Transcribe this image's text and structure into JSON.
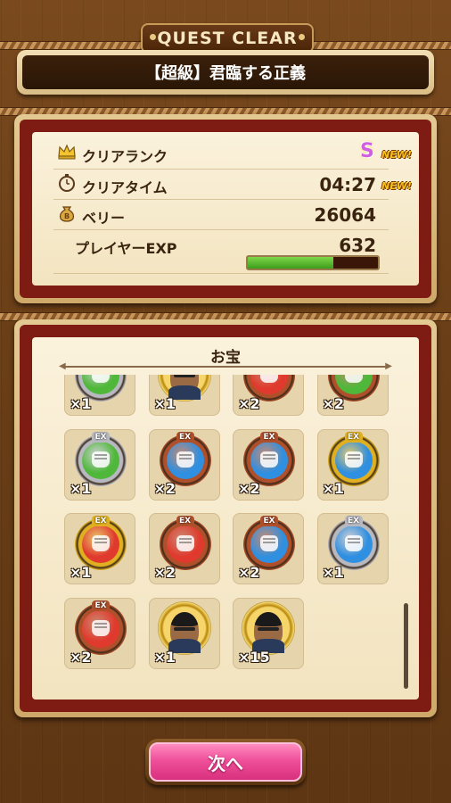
{
  "header": {
    "banner": "QUEST CLEAR",
    "quest_title": "【超級】君臨する正義"
  },
  "results": {
    "rank_label": "クリアランク",
    "rank_value": "S",
    "new_badge": "NEW!",
    "time_label": "クリアタイム",
    "time_value": "04:27",
    "berry_label": "ベリー",
    "berry_value": "26064",
    "exp_label": "プレイヤーEXP",
    "exp_value": "632",
    "exp_progress": 0.66
  },
  "treasure": {
    "title": "お宝",
    "ex_label": "EX",
    "items": [
      {
        "kind": "medal",
        "color": "green",
        "ring": "silver",
        "qty": "×1"
      },
      {
        "kind": "portrait",
        "qty": "×1"
      },
      {
        "kind": "medal",
        "color": "red",
        "ring": "bronze",
        "qty": "×2"
      },
      {
        "kind": "medal",
        "color": "green",
        "ring": "bronze",
        "qty": "×2"
      },
      {
        "kind": "medal",
        "color": "green",
        "ring": "silver",
        "qty": "×1"
      },
      {
        "kind": "medal",
        "color": "blue",
        "ring": "bronze",
        "qty": "×2"
      },
      {
        "kind": "medal",
        "color": "blue",
        "ring": "bronze",
        "qty": "×2"
      },
      {
        "kind": "medal",
        "color": "blue",
        "ring": "gold",
        "qty": "×1"
      },
      {
        "kind": "medal",
        "color": "red",
        "ring": "gold",
        "qty": "×1"
      },
      {
        "kind": "medal",
        "color": "red",
        "ring": "bronze",
        "qty": "×2"
      },
      {
        "kind": "medal",
        "color": "blue",
        "ring": "bronze",
        "qty": "×2"
      },
      {
        "kind": "medal",
        "color": "blue",
        "ring": "silver",
        "qty": "×1"
      },
      {
        "kind": "medal",
        "color": "red",
        "ring": "bronze",
        "qty": "×2"
      },
      {
        "kind": "portrait",
        "qty": "×1"
      },
      {
        "kind": "portrait",
        "qty": "×15"
      }
    ]
  },
  "footer": {
    "next_label": "次へ"
  },
  "colors": {
    "green": "#4fb83a",
    "red": "#e03a2e",
    "blue": "#2f8fe0",
    "silver": "#b8b8c0",
    "bronze": "#b0502a",
    "gold": "#e0b020"
  }
}
